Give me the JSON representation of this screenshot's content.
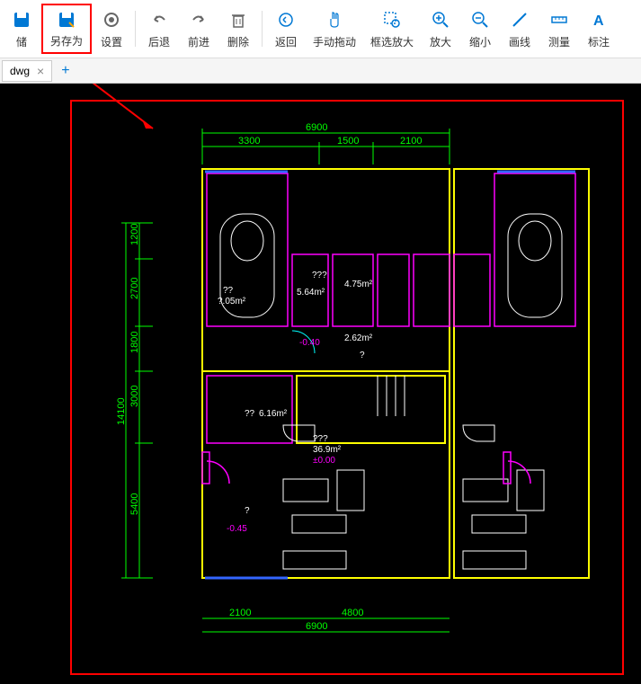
{
  "toolbar": {
    "save": "储",
    "save_as": "另存为",
    "settings": "设置",
    "back": "后退",
    "forward": "前进",
    "delete": "删除",
    "return": "返回",
    "pan": "手动拖动",
    "zoom_window": "框选放大",
    "zoom_in": "放大",
    "zoom_out": "缩小",
    "line": "画线",
    "measure": "测量",
    "label": "标注"
  },
  "tab": {
    "name": "dwg",
    "close": "×",
    "add": "+"
  },
  "drawing": {
    "dims_top": {
      "total": "6900",
      "d1": "3300",
      "d2": "1500",
      "d3": "2100"
    },
    "dims_bottom": {
      "total": "6900",
      "d1": "2100",
      "d2": "4800"
    },
    "dims_left": {
      "total": "14100",
      "d1": "1200",
      "d2": "2700",
      "d3": "1800",
      "d4": "3000",
      "d5": "5400"
    },
    "rooms": {
      "garage_area": "?.05m",
      "bath1": "5.64m",
      "bath2": "4.75m",
      "hall": "2.62m",
      "kitchen": "6.16m",
      "living": "36.9m",
      "elev1": "-0.40",
      "elev2": "±0.00",
      "elev3": "-0.45",
      "q1": "??",
      "q2": "??",
      "q3": "???",
      "q4": "???",
      "q5": "?",
      "q6": "?",
      "sq": "²"
    }
  }
}
